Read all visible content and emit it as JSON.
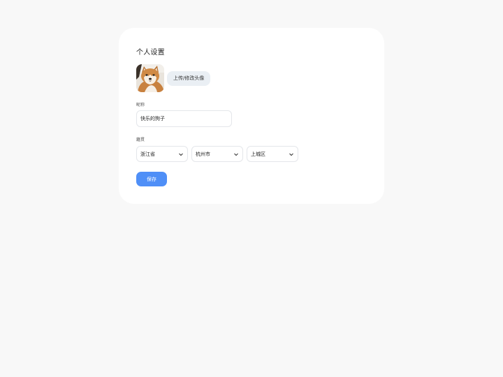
{
  "profile": {
    "title": "个人设置",
    "upload_label": "上传/修改头像",
    "nickname_label": "昵称",
    "nickname_value": "快乐的狗子",
    "hometown_label": "籍贯",
    "province": "浙江省",
    "city": "杭州市",
    "district": "上城区",
    "save_label": "保存"
  },
  "colors": {
    "page_bg": "#f8f8f8",
    "card_bg": "#ffffff",
    "upload_btn_bg": "#eaeff4",
    "save_btn_bg": "#4f8ff7"
  },
  "icons": {
    "avatar": "shiba-inu-dog-photo",
    "dropdown": "chevron-down-icon"
  }
}
